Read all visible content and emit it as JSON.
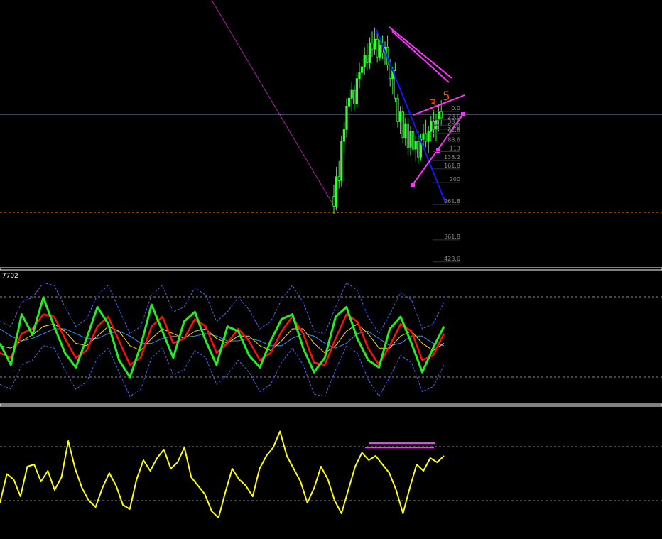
{
  "colors": {
    "background": "#000000",
    "candle": "#33ff33",
    "separator": "#ffffff",
    "price_line": "#7f83c8",
    "stop_line": "#ff8c00",
    "pattern_magenta": "#ff33ff",
    "trend_blue": "#1515ff",
    "wave_label": "#ff4500",
    "fib_text": "#8a8a8a",
    "osc_fast": "#22ee22",
    "osc_slow": "#ff1010",
    "osc_signal": "#ffd700",
    "osc_ma": "#2a95ff",
    "band": "#4b63ff",
    "cci_line": "#ffff00",
    "level": "#8a8a8a"
  },
  "wave_labels": [
    "3",
    "5"
  ],
  "fib_levels": [
    "0.0",
    "23.6",
    "38.2",
    "50.0",
    "61.8",
    "88.6",
    "113",
    "138.2",
    "161.8",
    "200",
    "261.8",
    "361.8",
    "423.6"
  ],
  "indicator_value": ".7702",
  "chart_data": [
    {
      "panel": "price",
      "type": "candlestick",
      "candles_ohlc": [
        [
          100,
          106,
          91,
          95
        ],
        [
          95,
          115,
          93,
          110
        ],
        [
          110,
          118,
          104,
          108
        ],
        [
          108,
          131,
          105,
          128
        ],
        [
          128,
          138,
          122,
          134
        ],
        [
          134,
          150,
          130,
          146
        ],
        [
          146,
          156,
          140,
          150
        ],
        [
          150,
          158,
          143,
          154
        ],
        [
          154,
          157,
          144,
          147
        ],
        [
          147,
          163,
          145,
          160
        ],
        [
          160,
          168,
          155,
          163
        ],
        [
          163,
          170,
          158,
          166
        ],
        [
          166,
          176,
          162,
          172
        ],
        [
          172,
          178,
          164,
          168
        ],
        [
          168,
          181,
          165,
          178
        ],
        [
          178,
          184,
          171,
          175
        ],
        [
          175,
          186,
          172,
          180
        ],
        [
          180,
          184,
          168,
          171
        ],
        [
          171,
          180,
          169,
          177
        ],
        [
          177,
          182,
          170,
          173
        ],
        [
          173,
          179,
          167,
          176
        ],
        [
          176,
          182,
          164,
          167
        ],
        [
          167,
          170,
          156,
          160
        ],
        [
          160,
          166,
          152,
          164
        ],
        [
          164,
          168,
          148,
          150
        ],
        [
          150,
          152,
          135,
          138
        ],
        [
          138,
          146,
          132,
          143
        ],
        [
          143,
          146,
          127,
          130
        ],
        [
          130,
          140,
          126,
          137
        ],
        [
          137,
          140,
          121,
          125
        ],
        [
          125,
          136,
          121,
          133
        ],
        [
          133,
          136,
          121,
          124
        ],
        [
          124,
          131,
          118,
          128
        ],
        [
          128,
          133,
          117,
          120
        ],
        [
          120,
          132,
          118,
          129
        ],
        [
          129,
          137,
          124,
          132
        ],
        [
          132,
          139,
          125,
          128
        ],
        [
          128,
          136,
          122,
          133
        ],
        [
          133,
          141,
          128,
          138
        ],
        [
          138,
          144,
          130,
          134
        ],
        [
          134,
          142,
          128,
          139
        ],
        [
          139,
          147,
          133,
          143
        ],
        [
          143,
          149,
          136,
          140
        ]
      ],
      "levels": {
        "price_line": 150,
        "stop_line": 105
      },
      "wave_labels": [
        "3",
        "5"
      ],
      "fib_levels": [
        0.0,
        23.6,
        38.2,
        50.0,
        61.8,
        88.6,
        113,
        138.2,
        161.8,
        200,
        261.8,
        361.8,
        423.6
      ]
    },
    {
      "panel": "oscillator",
      "type": "line",
      "series": [
        {
          "color": "#22ee22",
          "values": [
            48,
            30,
            72,
            55,
            86,
            62,
            40,
            28,
            52,
            78,
            64,
            34,
            20,
            46,
            80,
            58,
            36,
            66,
            74,
            50,
            30,
            62,
            58,
            38,
            28,
            50,
            68,
            72,
            44,
            24,
            36,
            70,
            78,
            52,
            34,
            28,
            60,
            70,
            48,
            24,
            44,
            62
          ]
        },
        {
          "color": "#ff1010",
          "values": [
            40,
            36,
            56,
            60,
            72,
            70,
            52,
            36,
            42,
            62,
            70,
            50,
            30,
            36,
            62,
            70,
            48,
            52,
            68,
            62,
            40,
            48,
            60,
            50,
            34,
            40,
            58,
            70,
            56,
            32,
            30,
            52,
            72,
            66,
            44,
            30,
            46,
            64,
            58,
            34,
            38,
            56
          ]
        },
        {
          "color": "#ffd700",
          "values": [
            46,
            44,
            50,
            55,
            62,
            64,
            58,
            48,
            46,
            54,
            62,
            58,
            46,
            42,
            52,
            60,
            56,
            52,
            58,
            60,
            52,
            48,
            54,
            54,
            46,
            42,
            50,
            60,
            60,
            48,
            40,
            46,
            58,
            64,
            56,
            44,
            44,
            54,
            58,
            48,
            42,
            48
          ]
        },
        {
          "color": "#2a95ff",
          "values": [
            60,
            54,
            50,
            52,
            56,
            60,
            60,
            56,
            52,
            52,
            56,
            58,
            54,
            48,
            48,
            52,
            54,
            53,
            54,
            56,
            54,
            50,
            50,
            52,
            50,
            46,
            46,
            52,
            56,
            54,
            48,
            44,
            48,
            56,
            58,
            52,
            46,
            48,
            54,
            54,
            48,
            46
          ]
        }
      ]
    },
    {
      "panel": "momentum",
      "type": "line",
      "values": [
        28,
        55,
        50,
        34,
        62,
        64,
        48,
        58,
        40,
        52,
        86,
        60,
        42,
        30,
        24,
        42,
        56,
        44,
        26,
        22,
        50,
        68,
        58,
        70,
        78,
        60,
        66,
        80,
        52,
        44,
        36,
        20,
        14,
        38,
        60,
        50,
        44,
        34,
        60,
        72,
        80,
        95,
        72,
        60,
        48,
        28,
        42,
        62,
        50,
        30,
        18,
        40,
        62,
        75,
        68,
        72,
        64,
        56,
        40,
        18,
        42,
        64,
        58,
        70,
        66,
        72
      ]
    }
  ]
}
